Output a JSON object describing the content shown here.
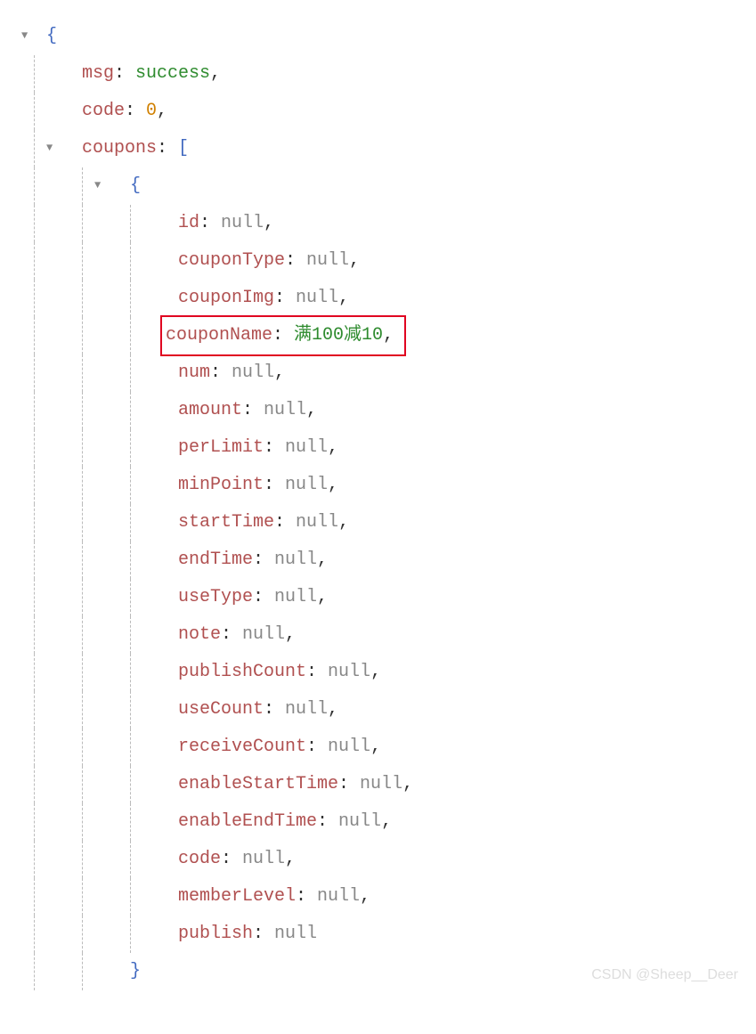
{
  "json": {
    "msg": {
      "key": "msg",
      "value": "success"
    },
    "code": {
      "key": "code",
      "value": "0"
    },
    "coupons": {
      "key": "coupons",
      "item": {
        "id": {
          "key": "id",
          "value": "null"
        },
        "couponType": {
          "key": "couponType",
          "value": "null"
        },
        "couponImg": {
          "key": "couponImg",
          "value": "null"
        },
        "couponName": {
          "key": "couponName",
          "value": "满100减10"
        },
        "num": {
          "key": "num",
          "value": "null"
        },
        "amount": {
          "key": "amount",
          "value": "null"
        },
        "perLimit": {
          "key": "perLimit",
          "value": "null"
        },
        "minPoint": {
          "key": "minPoint",
          "value": "null"
        },
        "startTime": {
          "key": "startTime",
          "value": "null"
        },
        "endTime": {
          "key": "endTime",
          "value": "null"
        },
        "useType": {
          "key": "useType",
          "value": "null"
        },
        "note": {
          "key": "note",
          "value": "null"
        },
        "publishCount": {
          "key": "publishCount",
          "value": "null"
        },
        "useCount": {
          "key": "useCount",
          "value": "null"
        },
        "receiveCount": {
          "key": "receiveCount",
          "value": "null"
        },
        "enableStartTime": {
          "key": "enableStartTime",
          "value": "null"
        },
        "enableEndTime": {
          "key": "enableEndTime",
          "value": "null"
        },
        "codeField": {
          "key": "code",
          "value": "null"
        },
        "memberLevel": {
          "key": "memberLevel",
          "value": "null"
        },
        "publish": {
          "key": "publish",
          "value": "null"
        }
      }
    }
  },
  "symbols": {
    "open_brace": "{",
    "close_brace": "}",
    "open_bracket": "[",
    "close_bracket": "]",
    "comma": ",",
    "colon": ": ",
    "toggle": "▼"
  },
  "watermark": "CSDN @Sheep__Deer"
}
